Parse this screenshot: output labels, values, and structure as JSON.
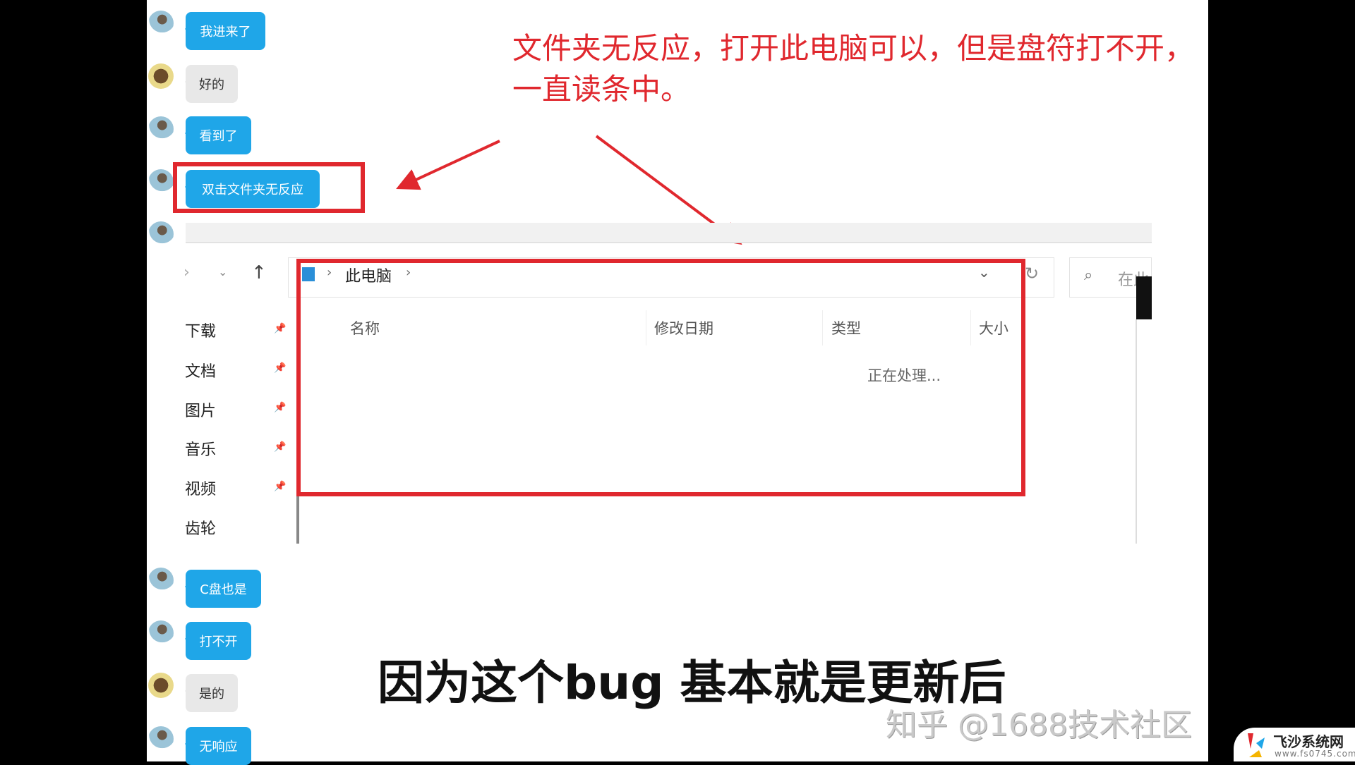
{
  "chat": {
    "messages_top": [
      {
        "text": "我进来了",
        "style": "blue"
      },
      {
        "text": "好的",
        "style": "gray"
      },
      {
        "text": "看到了",
        "style": "blue"
      },
      {
        "text": "双击文件夹无反应",
        "style": "blue"
      }
    ],
    "messages_bottom": [
      {
        "text": "C盘也是",
        "style": "blue"
      },
      {
        "text": "打不开",
        "style": "blue"
      },
      {
        "text": "是的",
        "style": "gray"
      },
      {
        "text": "无响应",
        "style": "blue"
      }
    ]
  },
  "annotation": {
    "line1": "文件夹无反应，打开此电脑可以，但是盘符打不开，",
    "line2": "一直读条中。",
    "color": "#e0282e"
  },
  "explorer": {
    "breadcrumb": [
      "此电脑"
    ],
    "search_placeholder": "在此",
    "sidebar": [
      {
        "label": "下载",
        "pinned": true
      },
      {
        "label": "文档",
        "pinned": true
      },
      {
        "label": "图片",
        "pinned": true
      },
      {
        "label": "音乐",
        "pinned": true
      },
      {
        "label": "视频",
        "pinned": true
      },
      {
        "label": "齿轮",
        "pinned": false
      }
    ],
    "columns": [
      "名称",
      "修改日期",
      "类型",
      "大小"
    ],
    "status": "正在处理..."
  },
  "subtitle": "因为这个bug 基本就是更新后",
  "watermark": "知乎 @1688技术社区",
  "logo": {
    "name": "飞沙系统网",
    "url_text": "www.fs0745.com"
  },
  "colors": {
    "bubble_blue": "#1fa6e8",
    "highlight_red": "#e0282e"
  }
}
